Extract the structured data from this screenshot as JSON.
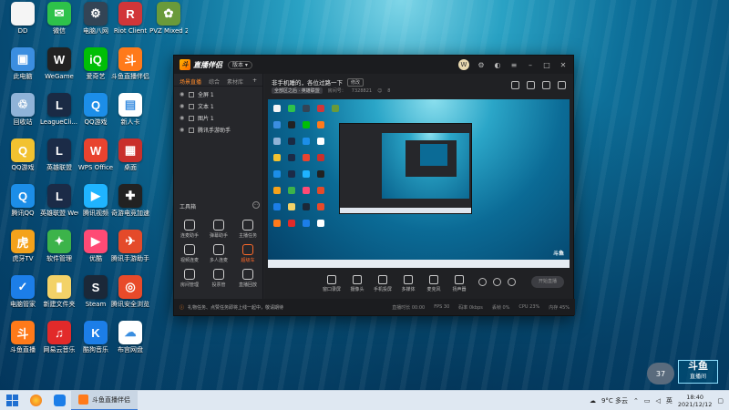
{
  "desktop_icons": [
    {
      "label": "DD",
      "color": "#f5f5f5",
      "glyph": ""
    },
    {
      "label": "微信",
      "color": "#2ec24a",
      "glyph": "✉"
    },
    {
      "label": "电脑八网",
      "color": "#334455",
      "glyph": "⚙"
    },
    {
      "label": "Riot Client",
      "color": "#d13639",
      "glyph": "R"
    },
    {
      "label": "PVZ Mixed 2.05 RTM...",
      "color": "#6a9a3a",
      "glyph": "✿"
    },
    {
      "label": "此电脑",
      "color": "#3b8ee0",
      "glyph": "▣"
    },
    {
      "label": "WeGame",
      "color": "#222222",
      "glyph": "W"
    },
    {
      "label": "爱奇艺",
      "color": "#00be06",
      "glyph": "iQ"
    },
    {
      "label": "斗鱼直播伴侣",
      "color": "#ff7a1a",
      "glyph": "斗"
    },
    {
      "label": "回收站",
      "color": "#8fb3d8",
      "glyph": "♲"
    },
    {
      "label": "LeagueCli... - 快捷方式",
      "color": "#1a2a44",
      "glyph": "L"
    },
    {
      "label": "QQ游戏",
      "color": "#1c8ee8",
      "glyph": "Q"
    },
    {
      "label": "新人卡",
      "color": "#ffffff",
      "glyph": "▤"
    },
    {
      "label": "QQ游戏",
      "color": "#f2c230",
      "glyph": "Q"
    },
    {
      "label": "英雄联盟",
      "color": "#1b2b47",
      "glyph": "L"
    },
    {
      "label": "WPS Office",
      "color": "#e8432f",
      "glyph": "W"
    },
    {
      "label": "桌面",
      "color": "#c9302c",
      "glyph": "▦"
    },
    {
      "label": "腾讯QQ",
      "color": "#1c8ee8",
      "glyph": "Q"
    },
    {
      "label": "英雄联盟 WeGame版",
      "color": "#1b2b47",
      "glyph": "L"
    },
    {
      "label": "腾讯视频",
      "color": "#1fb4ff",
      "glyph": "▶"
    },
    {
      "label": "奇游电竞加速器",
      "color": "#222222",
      "glyph": "✚"
    },
    {
      "label": "虎牙TV",
      "color": "#f4a21b",
      "glyph": "虎"
    },
    {
      "label": "软件管理",
      "color": "#3cb34a",
      "glyph": "✦"
    },
    {
      "label": "优酷",
      "color": "#ff4a75",
      "glyph": "▶"
    },
    {
      "label": "腾讯手游助手",
      "color": "#e44a2a",
      "glyph": "✈"
    },
    {
      "label": "电脑管家",
      "color": "#1c7ee8",
      "glyph": "✓"
    },
    {
      "label": "新建文件夹",
      "color": "#f3d268",
      "glyph": "▮"
    },
    {
      "label": "Steam",
      "color": "#1b2838",
      "glyph": "S"
    },
    {
      "label": "腾讯安全浏览器",
      "color": "#e84a2a",
      "glyph": "◎"
    },
    {
      "label": "斗鱼直播",
      "color": "#ff7a1a",
      "glyph": "斗"
    },
    {
      "label": "网易云音乐",
      "color": "#e22a2a",
      "glyph": "♫"
    },
    {
      "label": "酷狗音乐",
      "color": "#1c7ee8",
      "glyph": "K"
    },
    {
      "label": "布宫网盘",
      "color": "#ffffff",
      "glyph": "☁"
    }
  ],
  "window": {
    "app_name": "直播伴侣",
    "version_badge": "版本 ▾",
    "avatar_letter": "W",
    "left_tabs": [
      "场景直播",
      "综合",
      "素材库"
    ],
    "scenes": [
      {
        "label": "全屏 1"
      },
      {
        "label": "文本 1"
      },
      {
        "label": "图片 1"
      },
      {
        "label": "腾讯手游助手"
      }
    ],
    "tools_title": "工具箱",
    "tools": [
      {
        "label": "连麦助手",
        "highlight": false
      },
      {
        "label": "弹幕助手",
        "highlight": false
      },
      {
        "label": "主播任务",
        "highlight": false
      },
      {
        "label": "视频连麦",
        "highlight": false
      },
      {
        "label": "多人连麦",
        "highlight": false
      },
      {
        "label": "超级车",
        "highlight": true
      },
      {
        "label": "房间管理",
        "highlight": false
      },
      {
        "label": "投票管",
        "highlight": false
      },
      {
        "label": "直播回放",
        "highlight": false
      }
    ],
    "room_title": "非手机睡的，各位过路一下",
    "room_edit": "修改",
    "room_category": "全部区之后 · 英雄联盟",
    "room_id_label": "房间号：",
    "room_id": "7328821",
    "viewers": "8",
    "controls": [
      {
        "label": "窗口录屏"
      },
      {
        "label": "摄像头"
      },
      {
        "label": "手机投屏"
      },
      {
        "label": "多媒体"
      },
      {
        "label": "麦克风"
      },
      {
        "label": "扬声器"
      }
    ],
    "live_button": "开始直播",
    "notice": "礼物任务、点赞任务即将上线一起中，敬请期待",
    "stats": [
      "直播时长 00:00",
      "FPS 30",
      "码率 0kbps",
      "丢帧 0%",
      "CPU 23%",
      "内存 45%"
    ]
  },
  "taskbar": {
    "active_app": "斗鱼直播伴侣",
    "weather": "9°C 多云",
    "ime": "英",
    "time": "18:40",
    "date": "2021/12/12"
  },
  "overlays": {
    "temp": "37",
    "douyu_brand": "斗鱼",
    "douyu_sub": "直播间"
  }
}
